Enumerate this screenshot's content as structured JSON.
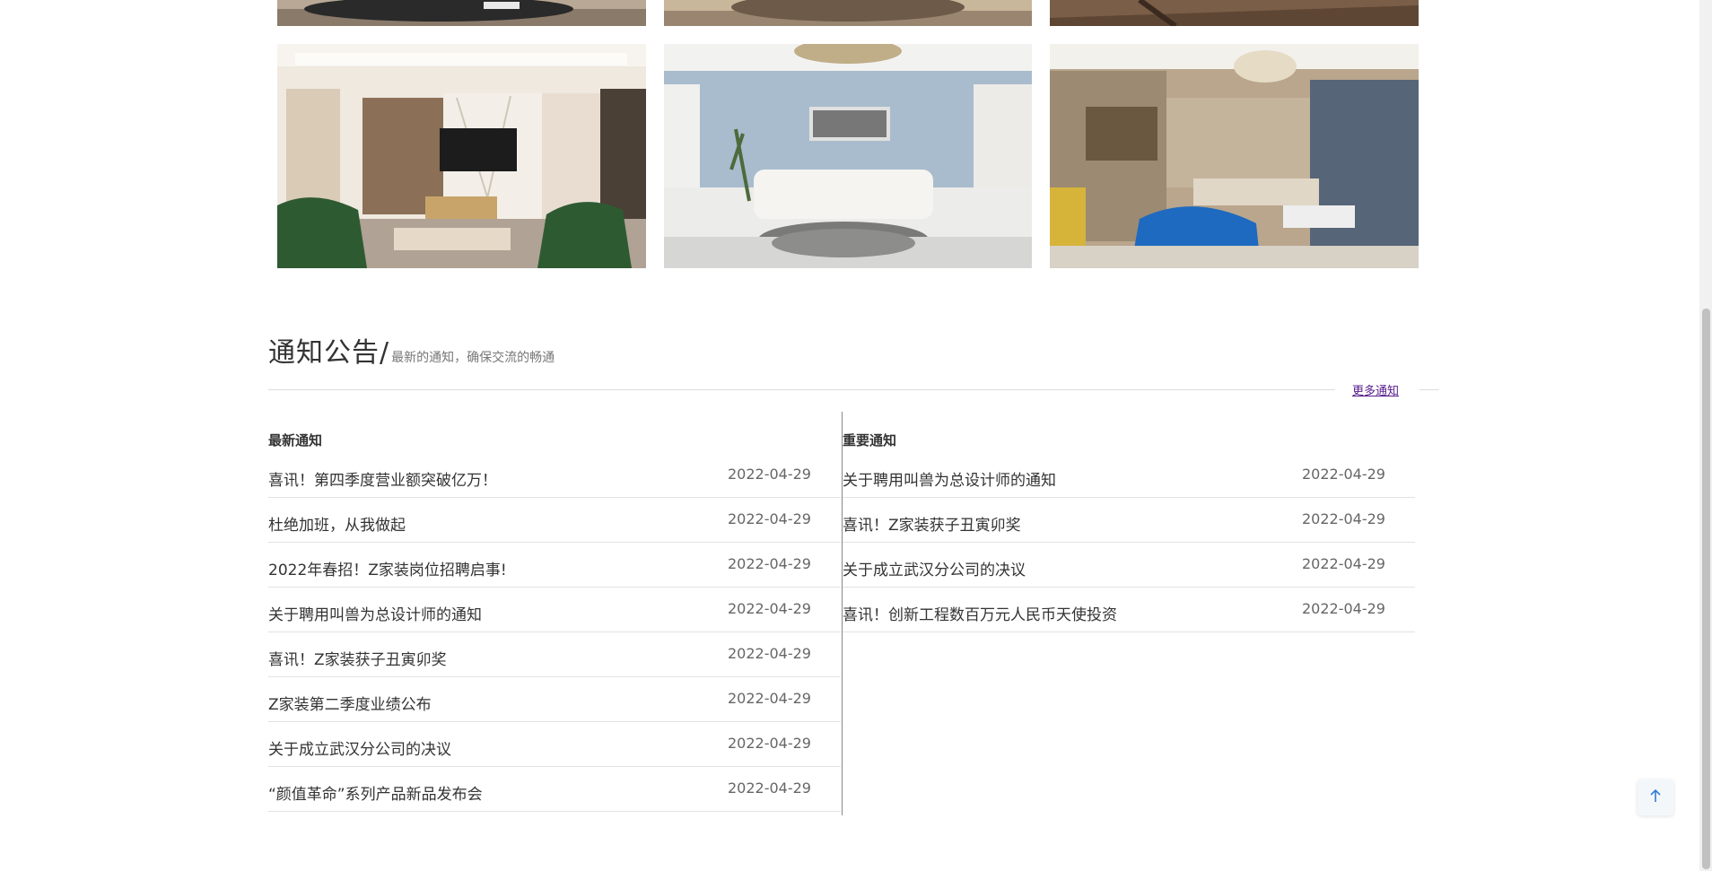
{
  "notices": {
    "title": "通知公告/",
    "subtitle": "最新的通知，确保交流的畅通",
    "more_link": "更多通知",
    "latest": {
      "heading": "最新通知",
      "items": [
        {
          "title": "喜讯！第四季度营业额突破亿万！",
          "date": "2022-04-29"
        },
        {
          "title": "杜绝加班，从我做起",
          "date": "2022-04-29"
        },
        {
          "title": "2022年春招！Z家装岗位招聘启事!",
          "date": "2022-04-29"
        },
        {
          "title": "关于聘用叫兽为总设计师的通知",
          "date": "2022-04-29"
        },
        {
          "title": "喜讯！Z家装获子丑寅卯奖",
          "date": "2022-04-29"
        },
        {
          "title": "Z家装第二季度业绩公布",
          "date": "2022-04-29"
        },
        {
          "title": "关于成立武汉分公司的决议",
          "date": "2022-04-29"
        },
        {
          "title": "“颜值革命”系列产品新品发布会",
          "date": "2022-04-29"
        }
      ]
    },
    "important": {
      "heading": "重要通知",
      "items": [
        {
          "title": "关于聘用叫兽为总设计师的通知",
          "date": "2022-04-29"
        },
        {
          "title": "喜讯！Z家装获子丑寅卯奖",
          "date": "2022-04-29"
        },
        {
          "title": "关于成立武汉分公司的决议",
          "date": "2022-04-29"
        },
        {
          "title": "喜讯！创新工程数百万元人民币天使投资",
          "date": "2022-04-29"
        }
      ]
    }
  },
  "icons": {
    "back_to_top": "arrow-up-icon"
  },
  "colors": {
    "link": "#551a8b",
    "back_top_arrow": "#2f7ed8",
    "divider": "#dddddd"
  }
}
